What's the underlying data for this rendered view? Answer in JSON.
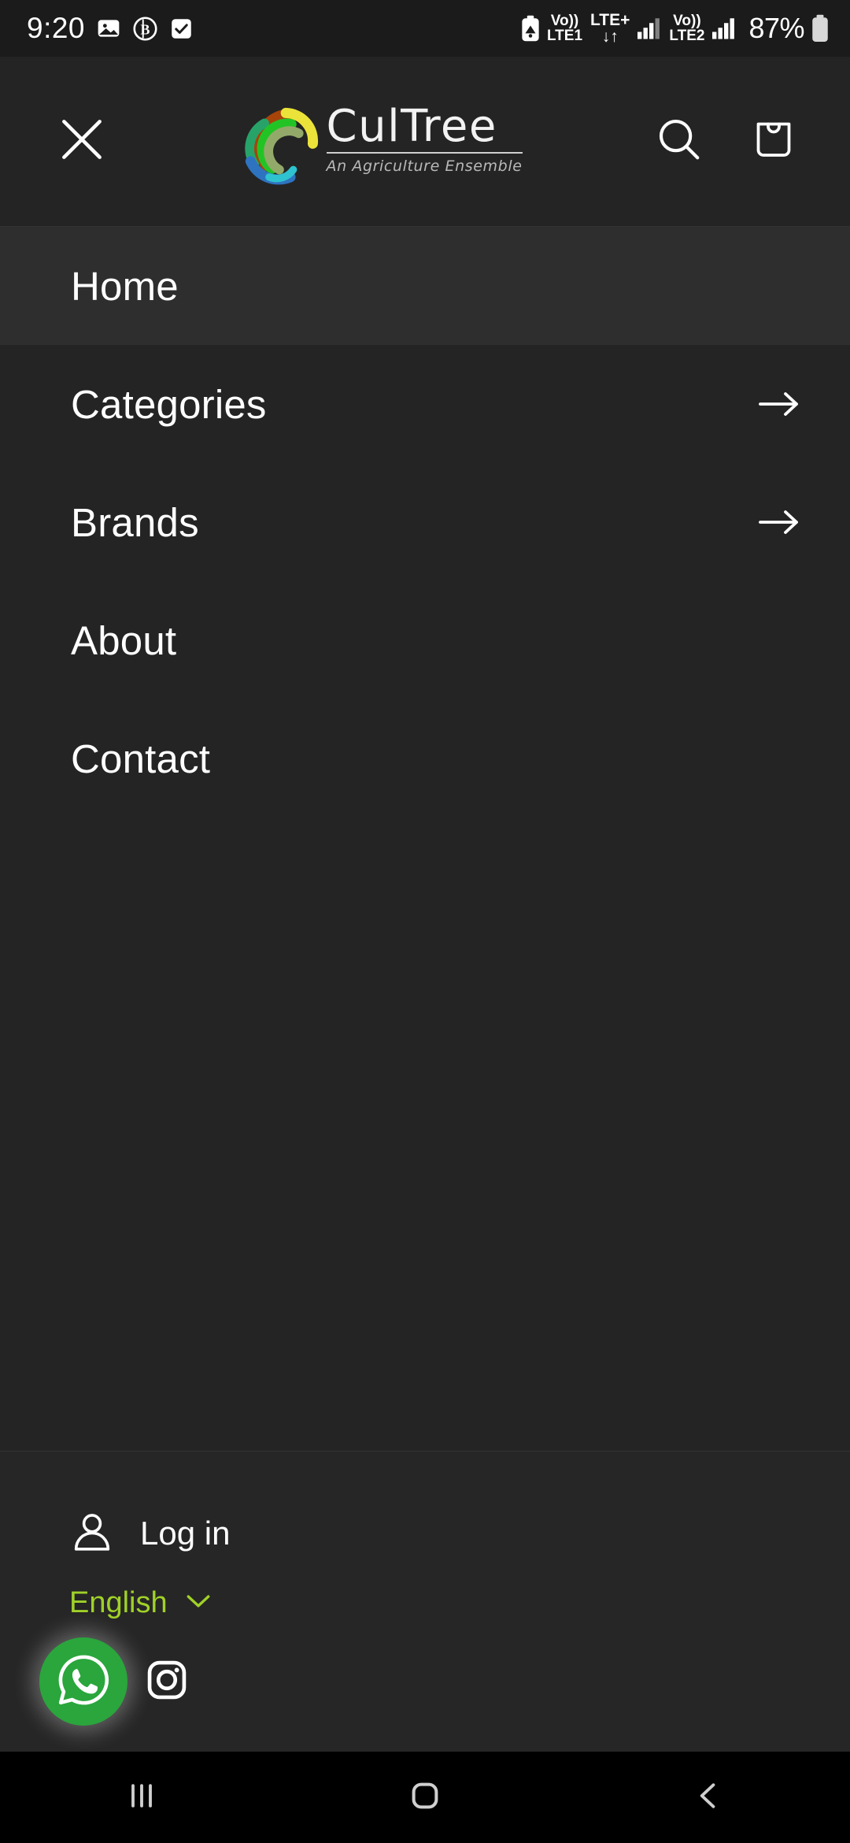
{
  "statusbar": {
    "clock": "9:20",
    "left_icons": [
      "photo-icon",
      "bitcoin-badge-icon",
      "checkbox-checked-icon"
    ],
    "battery_saver_icon": "battery-saver-icon",
    "sim1": {
      "volte": "Vo))",
      "label": "LTE1"
    },
    "network_type": {
      "top": "LTE+",
      "bottom": "↓↑"
    },
    "sim2": {
      "volte": "Vo))",
      "label": "LTE2"
    },
    "battery_percent": "87%"
  },
  "header": {
    "close_label": "close-icon",
    "logo": {
      "word": "CulTree",
      "tagline": "An Agriculture Ensemble",
      "mark": "cultree-swirl-logo",
      "colors": {
        "teal": "#27a36a",
        "green": "#22c425",
        "orange": "#a7440a",
        "yellow": "#ece33a",
        "olive": "#93a96a",
        "blue": "#2e73c0",
        "cyan": "#2fc2cf"
      }
    },
    "search_icon": "search-icon",
    "cart_icon": "shopping-bag-icon"
  },
  "menu": {
    "items": [
      {
        "label": "Home",
        "has_arrow": false,
        "active": true
      },
      {
        "label": "Categories",
        "has_arrow": true,
        "active": false
      },
      {
        "label": "Brands",
        "has_arrow": true,
        "active": false
      },
      {
        "label": "About",
        "has_arrow": false,
        "active": false
      },
      {
        "label": "Contact",
        "has_arrow": false,
        "active": false
      }
    ]
  },
  "footer": {
    "login_label": "Log in",
    "login_icon": "account-person-icon",
    "language": {
      "selected": "English",
      "chevron": "chevron-down-icon",
      "color": "#a0d128"
    },
    "social": [
      {
        "name": "whatsapp-icon",
        "color": "#2aa63c"
      },
      {
        "name": "instagram-icon",
        "color": "#ffffff"
      }
    ]
  },
  "navbar": {
    "recents_label": "recents-icon",
    "home_label": "home-icon",
    "back_label": "back-icon"
  }
}
